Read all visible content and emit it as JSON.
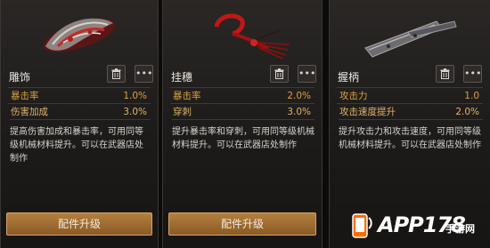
{
  "cards": [
    {
      "name": "雕饰",
      "stats": [
        {
          "label": "暴击率",
          "value": "1.0%"
        },
        {
          "label": "伤害加成",
          "value": "3.0%"
        }
      ],
      "description": "提高伤害加成和暴击率，可用同等级机械材料提升。可以在武器店处制作",
      "upgrade_label": "配件升级",
      "more_label": "•••",
      "icon": "ornament-icon"
    },
    {
      "name": "挂穗",
      "stats": [
        {
          "label": "暴击率",
          "value": "2.0%"
        },
        {
          "label": "穿刺",
          "value": "3.0%"
        }
      ],
      "description": "提升暴击率和穿刺，可用同等级机械材料提升。可以在武器店处制作",
      "upgrade_label": "配件升级",
      "more_label": "•••",
      "icon": "tassel-icon"
    },
    {
      "name": "握柄",
      "stats": [
        {
          "label": "攻击力",
          "value": "1.0"
        },
        {
          "label": "攻击速度提升",
          "value": "2.0%"
        }
      ],
      "description": "提升攻击力和攻击速度，可用同等级机械材料提升。可以在武器店处制作",
      "more_label": "•••",
      "icon": "grip-icon"
    }
  ],
  "watermark": {
    "text": "APP178",
    "sub": "手游网"
  },
  "colors": {
    "stat_text": "#d9a03a",
    "upgrade_button": "#a06d33"
  }
}
